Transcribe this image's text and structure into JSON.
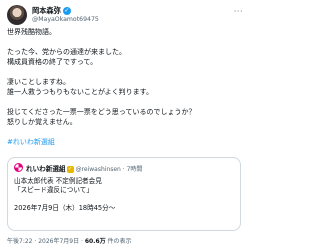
{
  "author": {
    "name": "岡本森弥",
    "handle": "@MayaOkamot69475"
  },
  "tweet": {
    "lines": [
      "世界残酷物語。",
      "たった今、党からの通達が来ました。",
      "構成員資格の終了ですって。",
      "凄いことしますね。",
      "誰一人救うつもりもないことがよく判ります。",
      "投じてくださった一票一票をどう思っているのでしょうか？",
      "怒りしか覚えません。"
    ],
    "hashtag": "#れいわ新選組"
  },
  "quoted": {
    "name": "れいわ新選組",
    "handle": "@reiwashinsen · 7時間",
    "lines": [
      "山本太郎代表 不定例記者会見",
      "「スピード違反について」",
      "",
      "2026年7月9日（木）18時45分～"
    ]
  },
  "footer": {
    "time": "午後7:22 · 2026年7月9日 · ",
    "views": "60.6万",
    "views_label": " 件の表示"
  },
  "icons": {
    "verified": "verified-badge-icon",
    "more": "more-options-icon",
    "quote_logo": "reiwa-logo-icon"
  },
  "colors": {
    "link": "#1d9bf0",
    "verified": "#1d9bf0",
    "quote_verified": "#e6b800"
  }
}
